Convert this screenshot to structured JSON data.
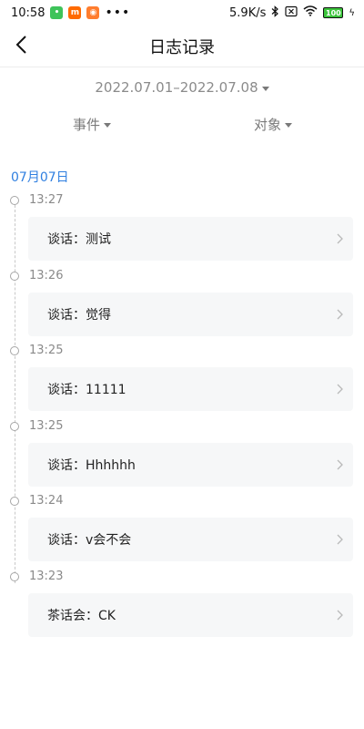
{
  "status_bar": {
    "time": "10:58",
    "more": "•••",
    "network_speed": "5.9K/s",
    "battery": "100"
  },
  "header": {
    "title": "日志记录"
  },
  "filters": {
    "date_range": "2022.07.01–2022.07.08",
    "events_label": "事件",
    "objects_label": "对象"
  },
  "day": {
    "label": "07月07日"
  },
  "entries": [
    {
      "time": "13:27",
      "text": "谈话：测试"
    },
    {
      "time": "13:26",
      "text": "谈话：觉得"
    },
    {
      "time": "13:25",
      "text": "谈话：11111"
    },
    {
      "time": "13:25",
      "text": "谈话：Hhhhhh"
    },
    {
      "time": "13:24",
      "text": "谈话：v会不会"
    },
    {
      "time": "13:23",
      "text": "茶话会：CK"
    }
  ],
  "colors": {
    "accent": "#2f7fe0",
    "card_bg": "#f6f7f8",
    "muted_text": "#8a8a8a"
  },
  "icons": {
    "back": "chevron-left-icon",
    "dropdown": "triangle-down-icon",
    "row_arrow": "chevron-right-icon"
  }
}
